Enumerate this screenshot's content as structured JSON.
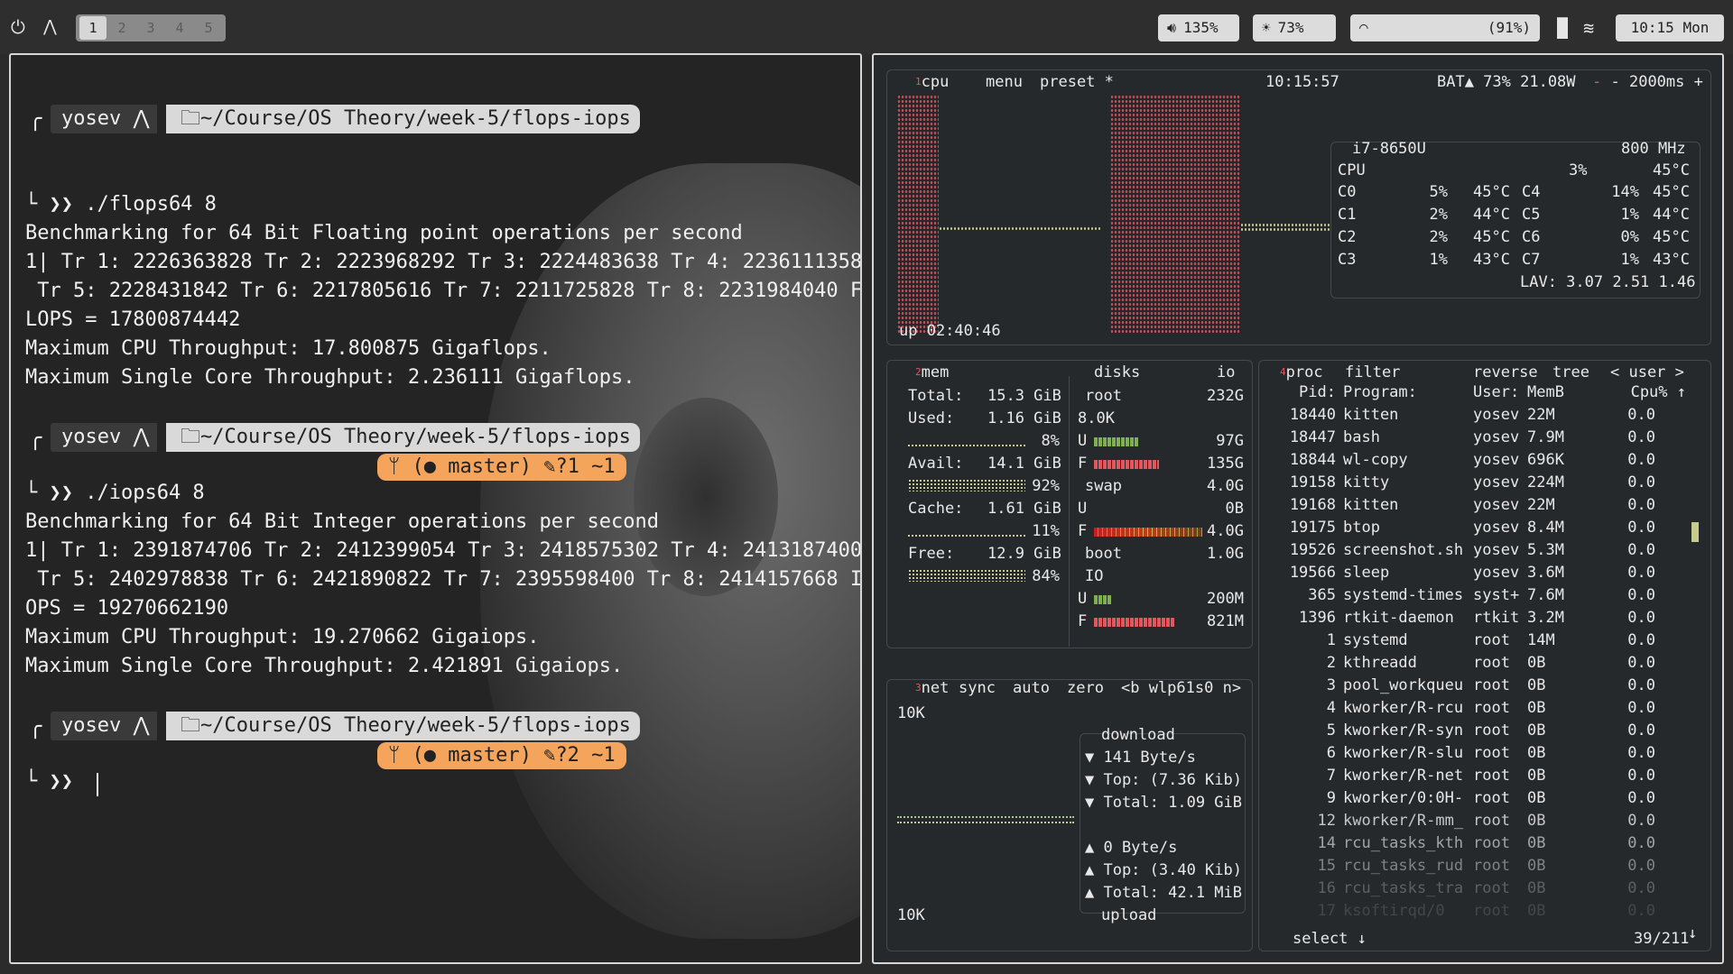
{
  "topbar": {
    "power_icon": "power-icon",
    "arch_icon": "arch-logo-icon",
    "workspaces": [
      "1",
      "2",
      "3",
      "4",
      "5"
    ],
    "active_workspace": "1",
    "volume": {
      "icon": "volume-icon",
      "text": "135%"
    },
    "brightness": {
      "icon": "brightness-icon",
      "text": "73%"
    },
    "wifi": {
      "icon": "wifi-icon",
      "text": "(91%)"
    },
    "stats_icon": "bar-chart-icon",
    "layers_icon": "layers-icon",
    "clock": "10:15 Mon"
  },
  "terminal": {
    "prompt_user": "yosev",
    "prompt_path": "~/Course/OS Theory/week-5/flops-iops",
    "git1": "( master) ⟳?1 ~1",
    "git2": "( master) ⟳?2 ~1",
    "git_branch": "master",
    "git_status_1": "?1 ~1",
    "git_status_2": "?2 ~1",
    "cmd1": "└ ❯❯ ./flops64 8",
    "out1": [
      "Benchmarking for 64 Bit Floating point operations per second",
      "1| Tr 1: 2226363828 Tr 2: 2223968292 Tr 3: 2224483638 Tr 4: 2236111358",
      " Tr 5: 2228431842 Tr 6: 2217805616 Tr 7: 2211725828 Tr 8: 2231984040 F",
      "LOPS = 17800874442",
      "Maximum CPU Throughput: 17.800875 Gigaflops.",
      "Maximum Single Core Throughput: 2.236111 Gigaflops."
    ],
    "cmd2": "└ ❯❯ ./iops64 8",
    "out2": [
      "Benchmarking for 64 Bit Integer operations per second",
      "1| Tr 1: 2391874706 Tr 2: 2412399054 Tr 3: 2418575302 Tr 4: 2413187400",
      " Tr 5: 2402978838 Tr 6: 2421890822 Tr 7: 2395598400 Tr 8: 2414157668 I",
      "OPS = 19270662190",
      "Maximum CPU Throughput: 19.270662 Gigaiops.",
      "Maximum Single Core Throughput: 2.421891 Gigaiops."
    ],
    "cmd3": "└ ❯❯ "
  },
  "btop": {
    "cpu_box": {
      "title": "cpu",
      "menu": "menu",
      "preset": "preset *",
      "time": "10:15:57",
      "battery": "BAT▲ 73% 21.08W",
      "interval": "- 2000ms +",
      "uptime": "up 02:40:46",
      "model": "i7-8650U",
      "freq": "800 MHz",
      "total": {
        "label": "CPU",
        "pct": "3%",
        "temp": "45°C"
      },
      "cores": [
        {
          "l": "C0",
          "p": "5%",
          "t": "45°C",
          "l2": "C4",
          "p2": "14%",
          "t2": "45°C"
        },
        {
          "l": "C1",
          "p": "2%",
          "t": "44°C",
          "l2": "C5",
          "p2": "1%",
          "t2": "44°C"
        },
        {
          "l": "C2",
          "p": "2%",
          "t": "45°C",
          "l2": "C6",
          "p2": "0%",
          "t2": "45°C"
        },
        {
          "l": "C3",
          "p": "1%",
          "t": "43°C",
          "l2": "C7",
          "p2": "1%",
          "t2": "43°C"
        }
      ],
      "lav": "LAV: 3.07 2.51 1.46"
    },
    "mem_box": {
      "title": "mem",
      "disks": "disks",
      "io": "io",
      "total": [
        "Total:",
        "15.3 GiB"
      ],
      "used": [
        "Used:",
        "1.16 GiB",
        "8%"
      ],
      "avail": [
        "Avail:",
        "14.1 GiB",
        "92%"
      ],
      "cache": [
        "Cache:",
        "1.61 GiB",
        "11%"
      ],
      "free": [
        "Free:",
        "12.9 GiB",
        "84%"
      ],
      "disk_root": [
        "root",
        "232G"
      ],
      "disk_root_io": "8.0K",
      "root_u": "97G",
      "root_f": "135G",
      "swap": [
        "swap",
        "4.0G"
      ],
      "swap_u": "0B",
      "swap_f": "4.0G",
      "boot": [
        "boot",
        "1.0G"
      ],
      "io_label": "IO",
      "boot_u": "200M",
      "boot_f": "821M"
    },
    "net_box": {
      "title": "net",
      "sync": "sync",
      "auto": "auto",
      "zero": "zero",
      "iface": "<b wlp61s0 n>",
      "scale_top": "10K",
      "scale_bottom": "10K",
      "download": "download",
      "dl_rate": "▼ 141 Byte/s",
      "dl_top": "▼ Top: (7.36 Kib)",
      "dl_total": "▼ Total: 1.09 GiB",
      "ul_rate": "▲ 0 Byte/s",
      "ul_top": "▲ Top: (3.40 Kib)",
      "ul_total": "▲ Total: 42.1 MiB",
      "upload": "upload"
    },
    "proc_box": {
      "title": "proc",
      "filter": "filter",
      "reverse": "reverse",
      "tree": "tree",
      "user": "< user >",
      "headers": [
        "Pid:",
        "Program:",
        "User:",
        "MemB",
        "Cpu% ↑"
      ],
      "rows": [
        [
          "18440",
          "kitten",
          "yosev",
          "22M",
          "0.0"
        ],
        [
          "18447",
          "bash",
          "yosev",
          "7.9M",
          "0.0"
        ],
        [
          "18844",
          "wl-copy",
          "yosev",
          "696K",
          "0.0"
        ],
        [
          "19158",
          "kitty",
          "yosev",
          "224M",
          "0.0"
        ],
        [
          "19168",
          "kitten",
          "yosev",
          "22M",
          "0.0"
        ],
        [
          "19175",
          "btop",
          "yosev",
          "8.4M",
          "0.0"
        ],
        [
          "19526",
          "screenshot.sh",
          "yosev",
          "5.3M",
          "0.0"
        ],
        [
          "19566",
          "sleep",
          "yosev",
          "3.6M",
          "0.0"
        ],
        [
          "365",
          "systemd-times",
          "syst+",
          "7.6M",
          "0.0"
        ],
        [
          "1396",
          "rtkit-daemon",
          "rtkit",
          "3.2M",
          "0.0"
        ],
        [
          "1",
          "systemd",
          "root",
          "14M",
          "0.0"
        ],
        [
          "2",
          "kthreadd",
          "root",
          "0B",
          "0.0"
        ],
        [
          "3",
          "pool_workqueu",
          "root",
          "0B",
          "0.0"
        ],
        [
          "4",
          "kworker/R-rcu",
          "root",
          "0B",
          "0.0"
        ],
        [
          "5",
          "kworker/R-syn",
          "root",
          "0B",
          "0.0"
        ],
        [
          "6",
          "kworker/R-slu",
          "root",
          "0B",
          "0.0"
        ],
        [
          "7",
          "kworker/R-net",
          "root",
          "0B",
          "0.0"
        ],
        [
          "9",
          "kworker/0:0H-",
          "root",
          "0B",
          "0.0"
        ],
        [
          "12",
          "kworker/R-mm_",
          "root",
          "0B",
          "0.0"
        ],
        [
          "14",
          "rcu_tasks_kth",
          "root",
          "0B",
          "0.0"
        ],
        [
          "15",
          "rcu_tasks_rud",
          "root",
          "0B",
          "0.0"
        ],
        [
          "16",
          "rcu_tasks_tra",
          "root",
          "0B",
          "0.0"
        ],
        [
          "17",
          "ksoftirqd/0",
          "root",
          "0B",
          "0.0"
        ]
      ],
      "select": "select ↓",
      "count": "39/211"
    }
  }
}
